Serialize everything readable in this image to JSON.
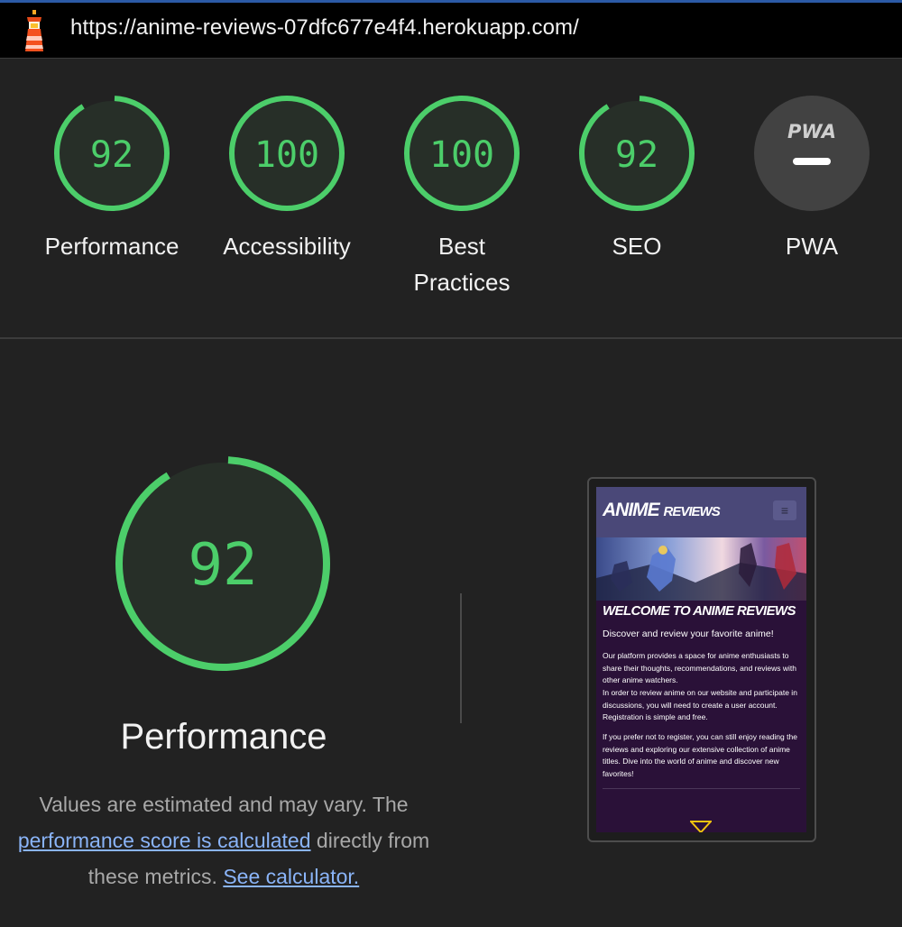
{
  "url": "https://anime-reviews-07dfc677e4f4.herokuapp.com/",
  "colors": {
    "pass": "#4cce6a",
    "pass_bg": "#272f28",
    "na": "#424242"
  },
  "categories": [
    {
      "score": "92",
      "label": "Performance",
      "fraction": 0.92
    },
    {
      "score": "100",
      "label": "Accessibility",
      "fraction": 1.0
    },
    {
      "score": "100",
      "label": "Best Practices",
      "fraction": 1.0
    },
    {
      "score": "92",
      "label": "SEO",
      "fraction": 0.92
    },
    {
      "score": "",
      "label": "PWA",
      "badge": "PWA"
    }
  ],
  "main": {
    "score": "92",
    "fraction": 0.92,
    "title": "Performance",
    "desc_part1": "Values are estimated and may vary. The ",
    "desc_link1": "performance score is calculated",
    "desc_part2": " directly from these metrics. ",
    "desc_link2": "See calculator."
  },
  "preview": {
    "logo_main": "ANIME",
    "logo_small": "REVIEWS",
    "menu_icon": "hamburger-icon",
    "welcome": "WELCOME TO ANIME REVIEWS",
    "subtitle": "Discover and review your favorite anime!",
    "para1": "Our platform provides a space for anime enthusiasts to share their thoughts, recommendations, and reviews with other anime watchers.",
    "para2": "In order to review anime on our website and participate in discussions, you will need to create a user account. Registration is simple and free.",
    "para3": "If you prefer not to register, you can still enjoy reading the reviews and exploring our extensive collection of anime titles. Dive into the world of anime and discover new favorites!"
  }
}
